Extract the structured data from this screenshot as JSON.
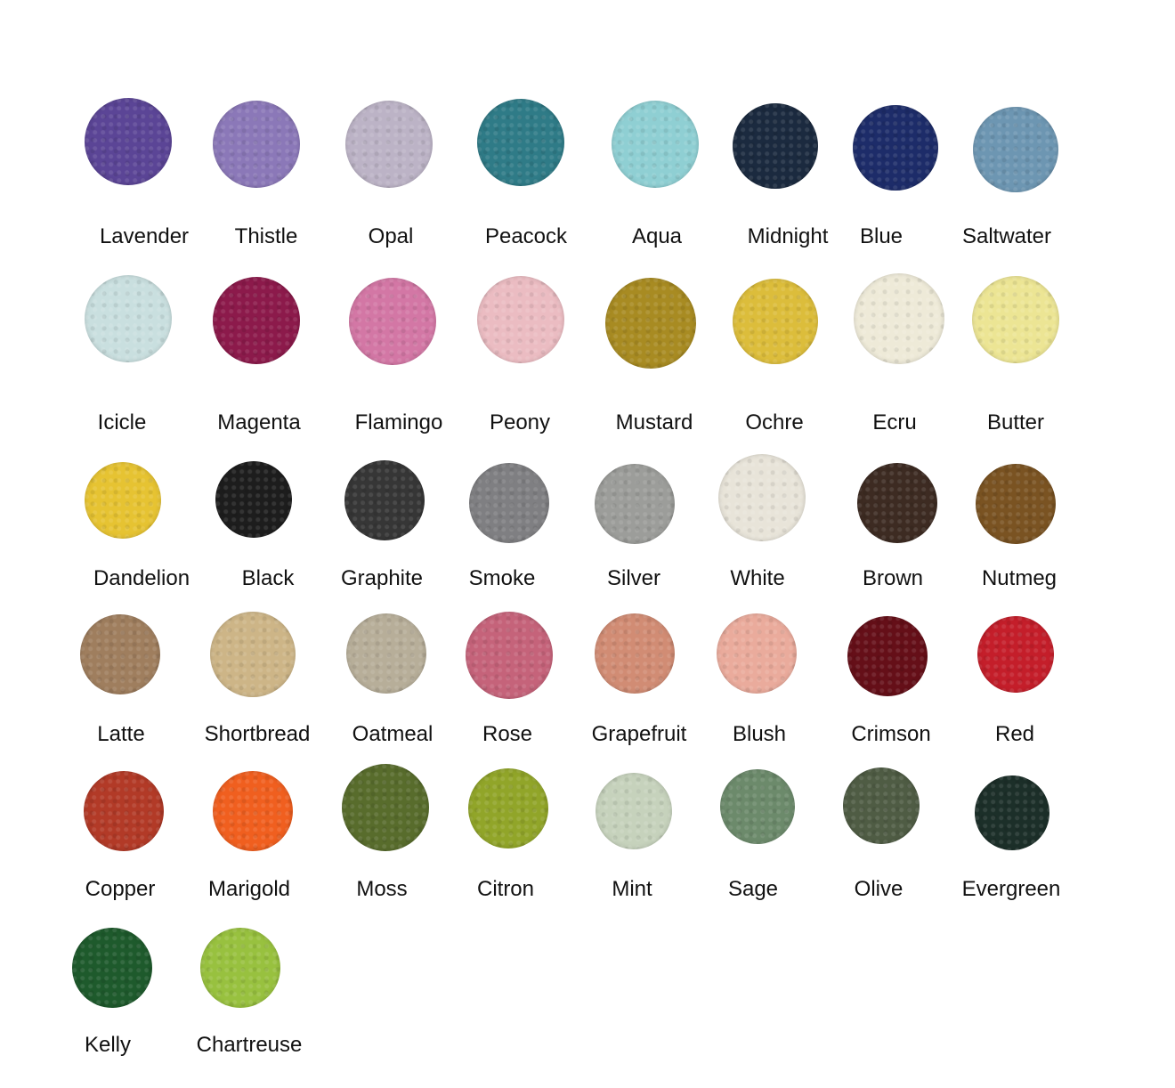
{
  "colors": [
    {
      "name": "Lavender",
      "hex": "#5b4596"
    },
    {
      "name": "Thistle",
      "hex": "#8b78b8"
    },
    {
      "name": "Opal",
      "hex": "#bcb3c6"
    },
    {
      "name": "Peacock",
      "hex": "#2f7b87"
    },
    {
      "name": "Aqua",
      "hex": "#8fcfd3"
    },
    {
      "name": "Midnight",
      "hex": "#1b2a3f"
    },
    {
      "name": "Blue",
      "hex": "#1d2c69"
    },
    {
      "name": "Saltwater",
      "hex": "#6d96b2"
    },
    {
      "name": "Icicle",
      "hex": "#c9dfdf"
    },
    {
      "name": "Magenta",
      "hex": "#8c1a4b"
    },
    {
      "name": "Flamingo",
      "hex": "#d377a5"
    },
    {
      "name": "Peony",
      "hex": "#ebbcc2"
    },
    {
      "name": "Mustard",
      "hex": "#a88b22"
    },
    {
      "name": "Ochre",
      "hex": "#dcbd3b"
    },
    {
      "name": "Ecru",
      "hex": "#eeead8"
    },
    {
      "name": "Butter",
      "hex": "#ece594"
    },
    {
      "name": "Dandelion",
      "hex": "#e6c332"
    },
    {
      "name": "Black",
      "hex": "#1d1d1d"
    },
    {
      "name": "Graphite",
      "hex": "#363636"
    },
    {
      "name": "Smoke",
      "hex": "#7f7f82"
    },
    {
      "name": "Silver",
      "hex": "#9c9d9a"
    },
    {
      "name": "White",
      "hex": "#e8e4d9"
    },
    {
      "name": "Brown",
      "hex": "#3d2b22"
    },
    {
      "name": "Nutmeg",
      "hex": "#7a5322"
    },
    {
      "name": "Latte",
      "hex": "#9f7e5e"
    },
    {
      "name": "Shortbread",
      "hex": "#cdb587"
    },
    {
      "name": "Oatmeal",
      "hex": "#b7ae99"
    },
    {
      "name": "Rose",
      "hex": "#c5637a"
    },
    {
      "name": "Grapefruit",
      "hex": "#d18c74"
    },
    {
      "name": "Blush",
      "hex": "#eaab9c"
    },
    {
      "name": "Crimson",
      "hex": "#650f18"
    },
    {
      "name": "Red",
      "hex": "#c41e2a"
    },
    {
      "name": "Copper",
      "hex": "#b23a27"
    },
    {
      "name": "Marigold",
      "hex": "#f05f1f"
    },
    {
      "name": "Moss",
      "hex": "#586c2c"
    },
    {
      "name": "Citron",
      "hex": "#91a529"
    },
    {
      "name": "Mint",
      "hex": "#c6d2bc"
    },
    {
      "name": "Sage",
      "hex": "#6c8a6b"
    },
    {
      "name": "Olive",
      "hex": "#4f5c44"
    },
    {
      "name": "Evergreen",
      "hex": "#1c2f29"
    },
    {
      "name": "Kelly",
      "hex": "#1e5a2c"
    },
    {
      "name": "Chartreuse",
      "hex": "#98c13f"
    }
  ]
}
